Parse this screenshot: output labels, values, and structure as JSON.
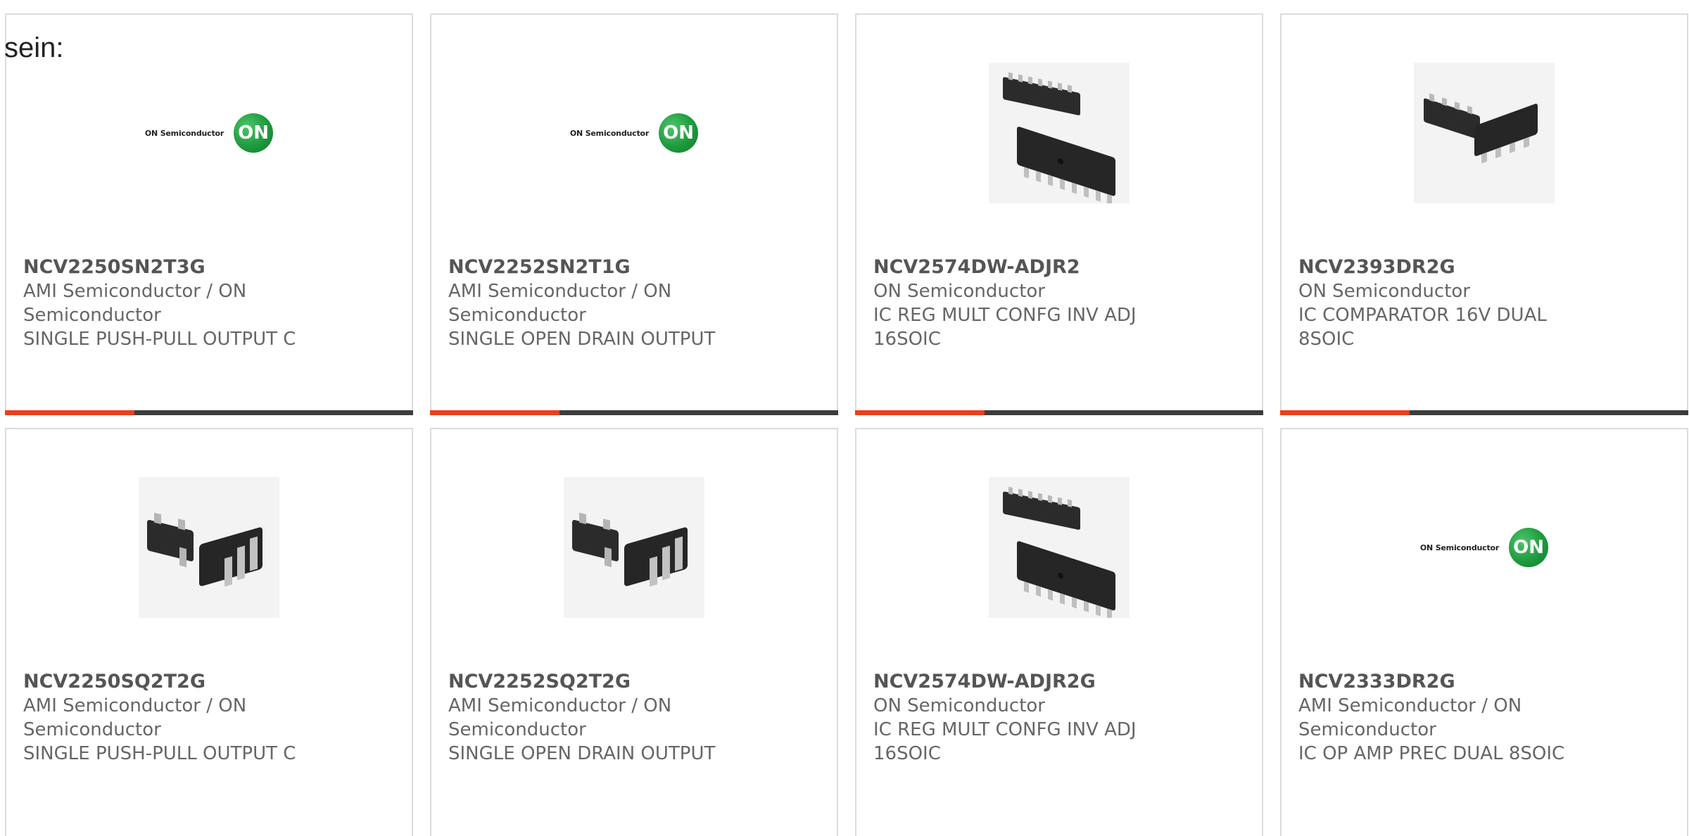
{
  "page": {
    "heading": "sein:"
  },
  "colors": {
    "accent": "#e8401c",
    "bar": "#3c3c3c",
    "logo_green": "#1e9a3e"
  },
  "products": [
    {
      "part_number": "NCV2250SN2T3G",
      "manufacturer": "AMI Semiconductor / ON Semiconductor",
      "description": "SINGLE PUSH-PULL OUTPUT C",
      "image": "on-semiconductor-logo",
      "logo_text": "ON Semiconductor",
      "logo_mark": "ON"
    },
    {
      "part_number": "NCV2252SN2T1G",
      "manufacturer": "AMI Semiconductor / ON Semiconductor",
      "description": "SINGLE OPEN DRAIN OUTPUT",
      "image": "on-semiconductor-logo",
      "logo_text": "ON Semiconductor",
      "logo_mark": "ON"
    },
    {
      "part_number": "NCV2574DW-ADJR2",
      "manufacturer": "ON Semiconductor",
      "description": "IC REG MULT CONFG INV ADJ 16SOIC",
      "image": "soic-16-chip"
    },
    {
      "part_number": "NCV2393DR2G",
      "manufacturer": "ON Semiconductor",
      "description": "IC COMPARATOR 16V DUAL 8SOIC",
      "image": "soic-8-chip"
    },
    {
      "part_number": "NCV2250SQ2T2G",
      "manufacturer": "AMI Semiconductor / ON Semiconductor",
      "description": "SINGLE PUSH-PULL OUTPUT C",
      "image": "sc-70-chip"
    },
    {
      "part_number": "NCV2252SQ2T2G",
      "manufacturer": "AMI Semiconductor / ON Semiconductor",
      "description": "SINGLE OPEN DRAIN OUTPUT",
      "image": "sc-70-chip"
    },
    {
      "part_number": "NCV2574DW-ADJR2G",
      "manufacturer": "ON Semiconductor",
      "description": "IC REG MULT CONFG INV ADJ 16SOIC",
      "image": "soic-16-chip"
    },
    {
      "part_number": "NCV2333DR2G",
      "manufacturer": "AMI Semiconductor / ON Semiconductor",
      "description": "IC OP AMP PREC DUAL 8SOIC",
      "image": "on-semiconductor-logo",
      "logo_text": "ON Semiconductor",
      "logo_mark": "ON"
    }
  ]
}
